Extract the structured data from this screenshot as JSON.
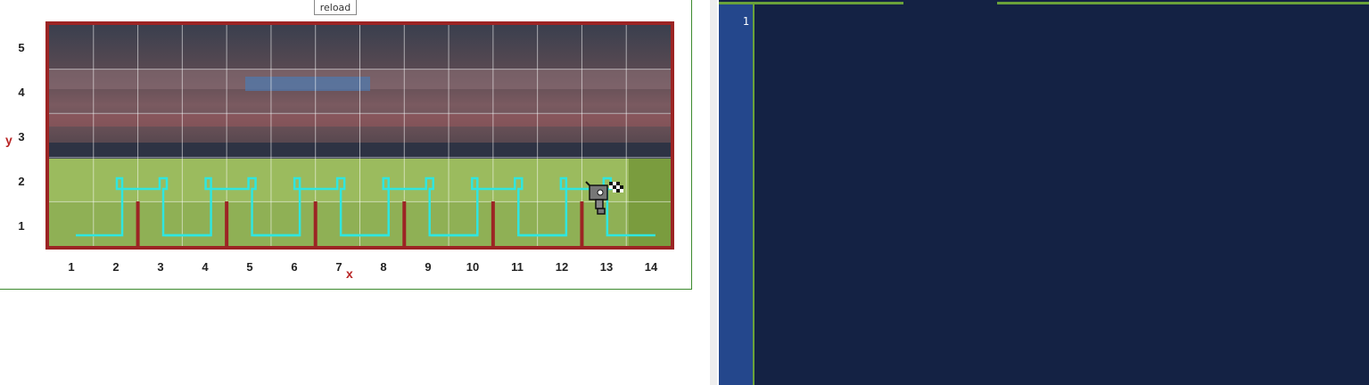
{
  "reload_label": "reload",
  "axes": {
    "x_label": "x",
    "y_label": "y"
  },
  "grid": {
    "columns": [
      "1",
      "2",
      "3",
      "4",
      "5",
      "6",
      "7",
      "8",
      "9",
      "10",
      "11",
      "12",
      "13",
      "14"
    ],
    "rows": [
      "5",
      "4",
      "3",
      "2",
      "1"
    ]
  },
  "editor": {
    "line_numbers": [
      "1"
    ],
    "code": ""
  },
  "colors": {
    "border": "#9c2424",
    "path": "#2fe6e0",
    "editor_bg": "#142244",
    "gutter_bg": "#24478c",
    "accent": "#6aa23a"
  }
}
